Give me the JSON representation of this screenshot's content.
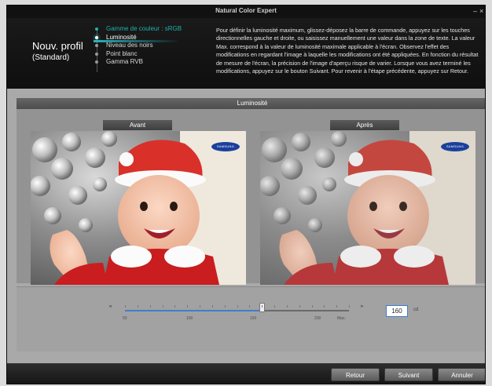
{
  "window": {
    "title": "Natural Color Expert",
    "minimize_glyph": "–",
    "close_glyph": "×"
  },
  "profile": {
    "name": "Nouv. profil",
    "subtitle": "(Standard)"
  },
  "steps": [
    {
      "label": "Gamme de couleur : sRGB",
      "state": "done"
    },
    {
      "label": "Luminosité",
      "state": "active"
    },
    {
      "label": "Niveau des noirs",
      "state": "pending"
    },
    {
      "label": "Point blanc",
      "state": "pending"
    },
    {
      "label": "Gamma RVB",
      "state": "pending"
    }
  ],
  "description": "Pour définir la luminosité maximum, glissez-déposez la barre de commande, appuyez sur les touches directionnelles gauche et droite, ou saisissez manuellement une valeur dans la zone de texte. La valeur Max. correspond à la valeur de luminosité maximale applicable à l'écran. Observez l'effet des modifications en regardant l'image à laquelle les modifications ont été appliquées. En fonction du résultat de mesure de l'écran, la précision de l'image d'aperçu risque de varier. Lorsque vous avez terminé les modifications, appuyez sur le bouton Suivant. Pour revenir à l'étape précédente, appuyez sur Retour.",
  "section": {
    "title": "Luminosité"
  },
  "preview": {
    "before_label": "Avant",
    "after_label": "Après",
    "logo_text": "SAMSUNG"
  },
  "slider": {
    "tick_labels": [
      "50",
      "100",
      "150",
      "200",
      "Max."
    ],
    "min": 50,
    "max": 230,
    "value": 160,
    "value_text": "160",
    "unit": "cd",
    "left_arrow": "◄",
    "right_arrow": "►",
    "fill_color": "#3b7fd1"
  },
  "buttons": {
    "back": "Retour",
    "next": "Suivant",
    "cancel": "Annuler"
  },
  "colors": {
    "accent": "#1eb3ae",
    "input_border": "#3a7fd0"
  }
}
